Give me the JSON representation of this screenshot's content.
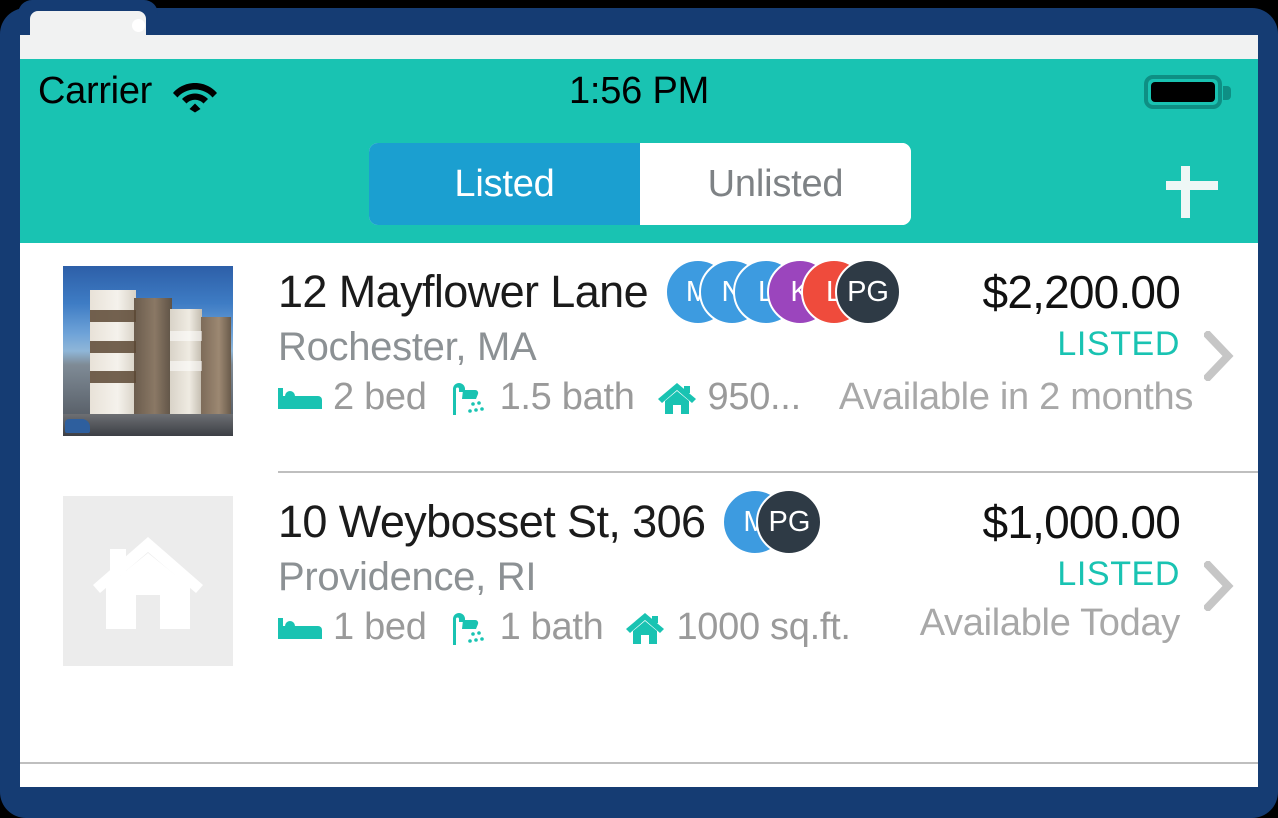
{
  "status_bar": {
    "carrier": "Carrier",
    "wifi_icon": "wifi-icon",
    "time": "1:56 PM",
    "battery_icon": "battery-full-icon"
  },
  "nav_bar": {
    "segments": [
      {
        "label": "Listed",
        "selected": true
      },
      {
        "label": "Unlisted",
        "selected": false
      }
    ],
    "add_button_icon": "plus-icon",
    "background_color": "#19C3B2",
    "selected_color": "#1B9FD0"
  },
  "listings": [
    {
      "thumbnail_type": "photo",
      "title": "12 Mayflower Lane",
      "location": "Rochester, MA",
      "beds": "2 bed",
      "baths": "1.5 bath",
      "area": "950...",
      "availability": "Available in 2 months",
      "price": "$2,200.00",
      "status": "LISTED",
      "avatars": [
        {
          "initials": "M",
          "color": "#3D9BE0"
        },
        {
          "initials": "N",
          "color": "#3D9BE0"
        },
        {
          "initials": "L",
          "color": "#3D9BE0"
        },
        {
          "initials": "K",
          "color": "#9B45BD"
        },
        {
          "initials": "L",
          "color": "#EF4B3C"
        },
        {
          "initials": "PG",
          "color": "#2E3A45"
        }
      ]
    },
    {
      "thumbnail_type": "placeholder",
      "title": "10 Weybosset St, 306",
      "location": "Providence, RI",
      "beds": "1 bed",
      "baths": "1 bath",
      "area": "1000 sq.ft.",
      "availability": "Available Today",
      "price": "$1,000.00",
      "status": "LISTED",
      "avatars": [
        {
          "initials": "M",
          "color": "#3D9BE0"
        },
        {
          "initials": "PG",
          "color": "#2E3A45"
        }
      ]
    }
  ],
  "icons": {
    "bed": "bed-icon",
    "bath": "shower-icon",
    "area": "house-icon",
    "chevron": "chevron-right-icon",
    "placeholder": "house-placeholder-icon"
  },
  "colors": {
    "teal": "#19C3B2",
    "blue": "#1B9FD0",
    "frame": "#153C73"
  }
}
